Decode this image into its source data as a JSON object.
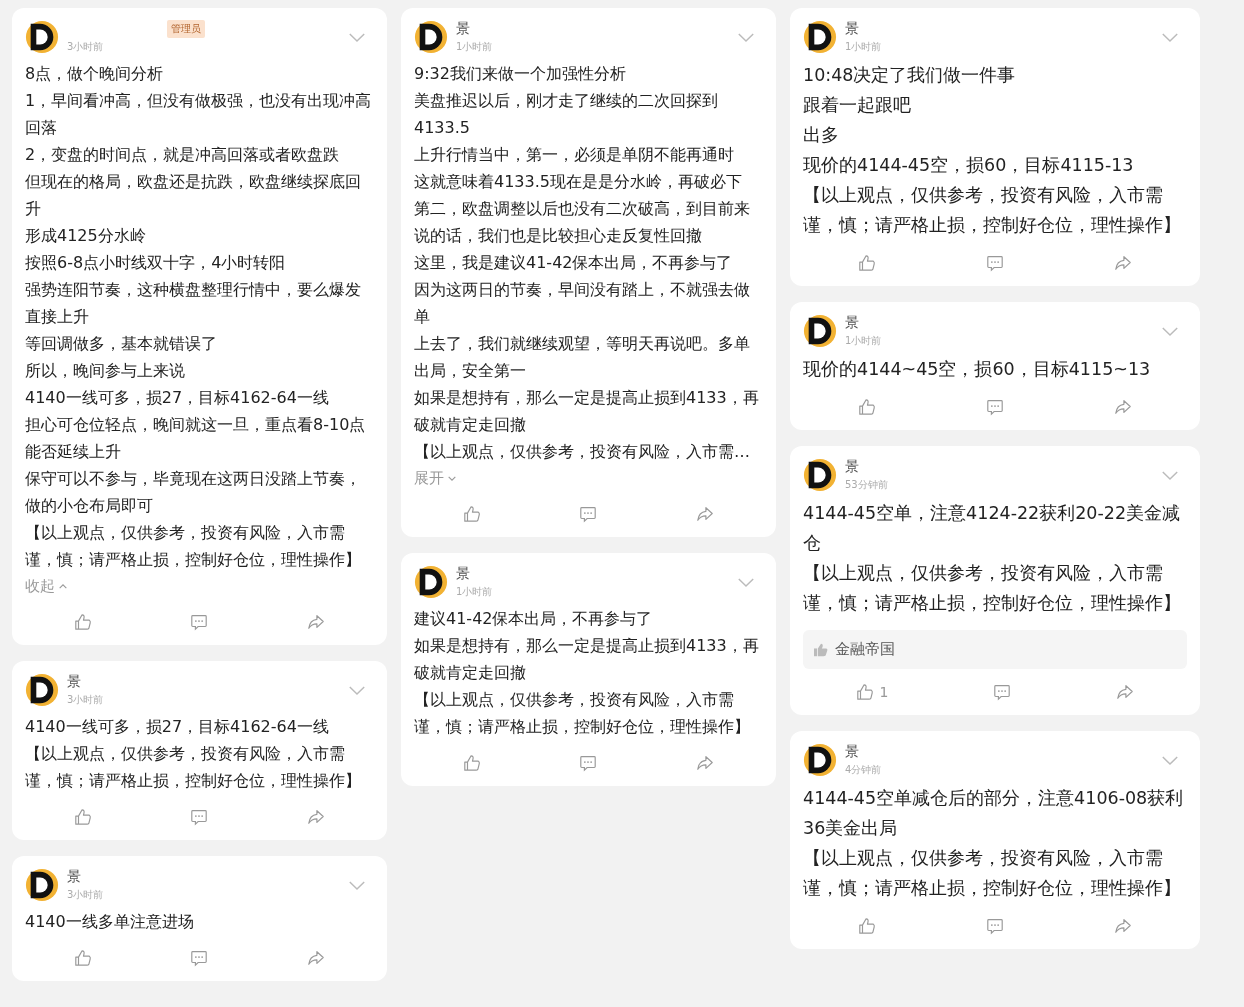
{
  "columns": [
    {
      "posts": [
        {
          "badge": "管理员",
          "time": "3小时前",
          "paragraphs": [
            "8点，做个晚间分析",
            "1，早间看冲高，但没有做极强，也没有出现冲高回落",
            "2，变盘的时间点，就是冲高回落或者欧盘跌",
            "但现在的格局，欧盘还是抗跌，欧盘继续探底回升",
            "形成4125分水岭",
            "按照6-8点小时线双十字，4小时转阳",
            "强势连阳节奏，这种横盘整理行情中，要么爆发直接上升",
            "等回调做多，基本就错误了",
            "所以，晚间参与上来说",
            "4140一线可多，损27，目标4162-64一线",
            "担心可仓位轻点，晚间就这一旦，重点看8-10点能否延续上升",
            "保守可以不参与，毕竟现在这两日没踏上节奏，做的小仓布局即可",
            "【以上观点，仅供参考，投资有风险，入市需谨，慎；请严格止损，控制好仓位，理性操作】"
          ],
          "toggle": {
            "label": "收起",
            "expanded": true
          }
        },
        {
          "author": "景",
          "time": "3小时前",
          "paragraphs": [
            "4140一线可多，损27，目标4162-64一线",
            "【以上观点，仅供参考，投资有风险，入市需谨，慎；请严格止损，控制好仓位，理性操作】"
          ]
        },
        {
          "author": "景",
          "time": "3小时前",
          "paragraphs": [
            "4140一线多单注意进场"
          ]
        }
      ]
    },
    {
      "posts": [
        {
          "author": "景",
          "time": "1小时前",
          "paragraphs": [
            "9:32我们来做一个加强性分析",
            "美盘推迟以后，刚才走了继续的二次回探到4133.5",
            "上升行情当中，第一，必须是单阴不能再通时",
            "这就意味着4133.5现在是是分水岭，再破必下",
            "第二，欧盘调整以后也没有二次破高，到目前来说的话，我们也是比较担心走反复性回撤",
            "这里，我是建议41-42保本出局，不再参与了",
            "因为这两日的节奏，早间没有踏上，不就强去做单",
            "上去了，我们就继续观望，等明天再说吧。多单出局，安全第一",
            "如果是想持有，那么一定是提高止损到4133，再破就肯定走回撤",
            "【以上观点，仅供参考，投资有风险，入市需…"
          ],
          "toggle": {
            "label": "展开",
            "expanded": false
          }
        },
        {
          "author": "景",
          "time": "1小时前",
          "paragraphs": [
            "建议41-42保本出局，不再参与了",
            "如果是想持有，那么一定是提高止损到4133，再破就肯定走回撤",
            "【以上观点，仅供参考，投资有风险，入市需谨，慎；请严格止损，控制好仓位，理性操作】"
          ]
        }
      ]
    },
    {
      "posts": [
        {
          "author": "景",
          "time": "1小时前",
          "paragraphs": [
            "10:48决定了我们做一件事",
            "跟着一起跟吧",
            "出多",
            "现价的4144-45空，损60，目标4115-13",
            "【以上观点，仅供参考，投资有风险，入市需谨，慎；请严格止损，控制好仓位，理性操作】"
          ]
        },
        {
          "author": "景",
          "time": "1小时前",
          "paragraphs": [
            "现价的4144~45空，损60，目标4115~13"
          ]
        },
        {
          "author": "景",
          "time": "53分钟前",
          "paragraphs": [
            "4144-45空单，注意4124-22获利20-22美金减仓",
            "【以上观点，仅供参考，投资有风险，入市需谨，慎；请严格止损，控制好仓位，理性操作】"
          ],
          "liked_by": "金融帝国",
          "like_count": "1"
        },
        {
          "author": "景",
          "time": "4分钟前",
          "paragraphs": [
            "4144-45空单减仓后的部分，注意4106-08获利36美金出局",
            "【以上观点，仅供参考，投资有风险，入市需谨，慎；请严格止损，控制好仓位，理性操作】"
          ]
        }
      ]
    }
  ]
}
